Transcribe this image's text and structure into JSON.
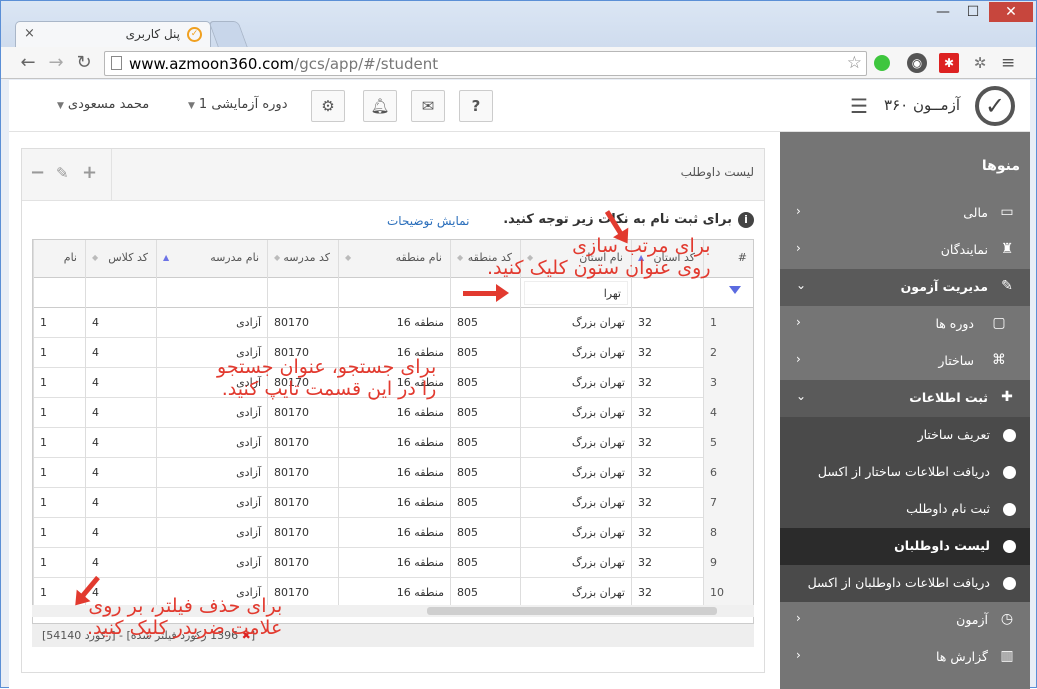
{
  "browser": {
    "tab_title": "پنل کاربری",
    "url_host": "www.azmoon360.com",
    "url_path": "/gcs/app/#/student",
    "win_min": "—",
    "win_max": "☐",
    "win_close": "✕"
  },
  "header": {
    "brand": "آزمــون ۳۶۰",
    "period_label": "دوره آزمایشی 1",
    "user_name": "محمد مسعودی"
  },
  "sidebar": {
    "title": "منوها",
    "items": [
      {
        "label": "مالی",
        "icon": "credit-card-icon"
      },
      {
        "label": "نمایندگان",
        "icon": "agent-icon"
      },
      {
        "label": "مدیریت آزمون",
        "icon": "edit-icon"
      },
      {
        "label": "دوره ها",
        "icon": "folder-icon"
      },
      {
        "label": "ساختار",
        "icon": "sitemap-icon"
      },
      {
        "label": "ثبت اطلاعات",
        "icon": "user-plus-icon"
      },
      {
        "label": "تعریف ساختار"
      },
      {
        "label": "دریافت اطلاعات ساختار از اکسل"
      },
      {
        "label": "ثبت نام داوطلب"
      },
      {
        "label": "لیست داوطلبان"
      },
      {
        "label": "دریافت اطلاعات داوطلبان از اکسل"
      },
      {
        "label": "آزمون",
        "icon": "clock-icon"
      },
      {
        "label": "گزارش ها",
        "icon": "bar-chart-icon"
      }
    ]
  },
  "panel": {
    "title": "لیست داوطلب",
    "notice": "برای ثبت نام به نکات زیر توجه کنید.",
    "show_desc": "نمایش توضیحات"
  },
  "grid": {
    "columns": [
      "#",
      "کد استان",
      "نام استان",
      "کد منطقه",
      "نام منطقه",
      "کد مدرسه",
      "نام مدرسه",
      "کد کلاس",
      "نام"
    ],
    "filter_value": "تهرا",
    "rows": [
      [
        "1",
        "32",
        "تهران بزرگ",
        "805",
        "منطقه 16",
        "80170",
        "آزادی",
        "4",
        "1"
      ],
      [
        "2",
        "32",
        "تهران بزرگ",
        "805",
        "منطقه 16",
        "80170",
        "آزادی",
        "4",
        "1"
      ],
      [
        "3",
        "32",
        "تهران بزرگ",
        "805",
        "منطقه 16",
        "80170",
        "آزادی",
        "4",
        "1"
      ],
      [
        "4",
        "32",
        "تهران بزرگ",
        "805",
        "منطقه 16",
        "80170",
        "آزادی",
        "4",
        "1"
      ],
      [
        "5",
        "32",
        "تهران بزرگ",
        "805",
        "منطقه 16",
        "80170",
        "آزادی",
        "4",
        "1"
      ],
      [
        "6",
        "32",
        "تهران بزرگ",
        "805",
        "منطقه 16",
        "80170",
        "آزادی",
        "4",
        "1"
      ],
      [
        "7",
        "32",
        "تهران بزرگ",
        "805",
        "منطقه 16",
        "80170",
        "آزادی",
        "4",
        "1"
      ],
      [
        "8",
        "32",
        "تهران بزرگ",
        "805",
        "منطقه 16",
        "80170",
        "آزادی",
        "4",
        "1"
      ],
      [
        "9",
        "32",
        "تهران بزرگ",
        "805",
        "منطقه 16",
        "80170",
        "آزادی",
        "4",
        "1"
      ],
      [
        "10",
        "32",
        "تهران بزرگ",
        "805",
        "منطقه 16",
        "80170",
        "آزادی",
        "4",
        "1"
      ]
    ],
    "footer_total": "[54140 رکورد]",
    "footer_sep": " - ",
    "footer_filtered": "[1396 رکورد فیلتر شده",
    "footer_clear": "✖",
    "footer_end": "]"
  },
  "annotations": {
    "sort_line1": "برای مرتب سازی",
    "sort_line2": "روی عنوان ستون کلیک کنید.",
    "search_line1": "برای جستجو، عنوان جستجو",
    "search_line2": "را در این قسمت تایپ کنید.",
    "filter_line1": "برای حذف فیلتر، بر روی",
    "filter_line2": "علامت ضربدر کلیک کنید."
  },
  "colors": {
    "annotation": "#e23a2f",
    "sidebar": "#757575",
    "sidebar_active": "#2b2b2b",
    "sort_active": "#6c73e6"
  }
}
